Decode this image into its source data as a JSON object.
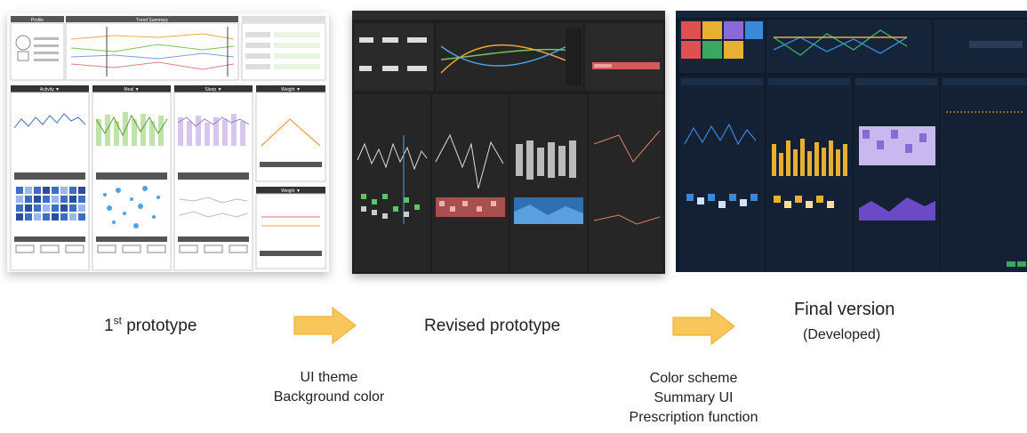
{
  "stages": [
    {
      "caption_main": "1",
      "caption_sup": "st",
      "caption_rest": " prototype"
    },
    {
      "caption_main": "Revised prototype"
    },
    {
      "caption_main": "Final version",
      "caption_sub": "(Developed)"
    }
  ],
  "transitions": [
    {
      "lines": [
        "UI theme",
        "Background color"
      ]
    },
    {
      "lines": [
        "Color scheme",
        "Summary UI",
        "Prescription function"
      ]
    }
  ],
  "shot1_labels": {
    "profile": "Profile",
    "trend": "Trend Summary",
    "activity": "Activity ▼",
    "meal": "Meal ▼",
    "sleep": "Sleep ▼",
    "weight": "Weight ▼",
    "weight2": "Weight ▼"
  },
  "colors": {
    "arrow": "#f8c65a",
    "arrow_edge": "#f0b23c",
    "proto_bg": "#ffffff",
    "revised_bg": "#1e1e1e",
    "final_bg": "#0f1a2a",
    "activity": "#3b6fc4",
    "meal": "#7cc452",
    "sleep": "#9b7ad6",
    "weight": "#f0a040"
  }
}
